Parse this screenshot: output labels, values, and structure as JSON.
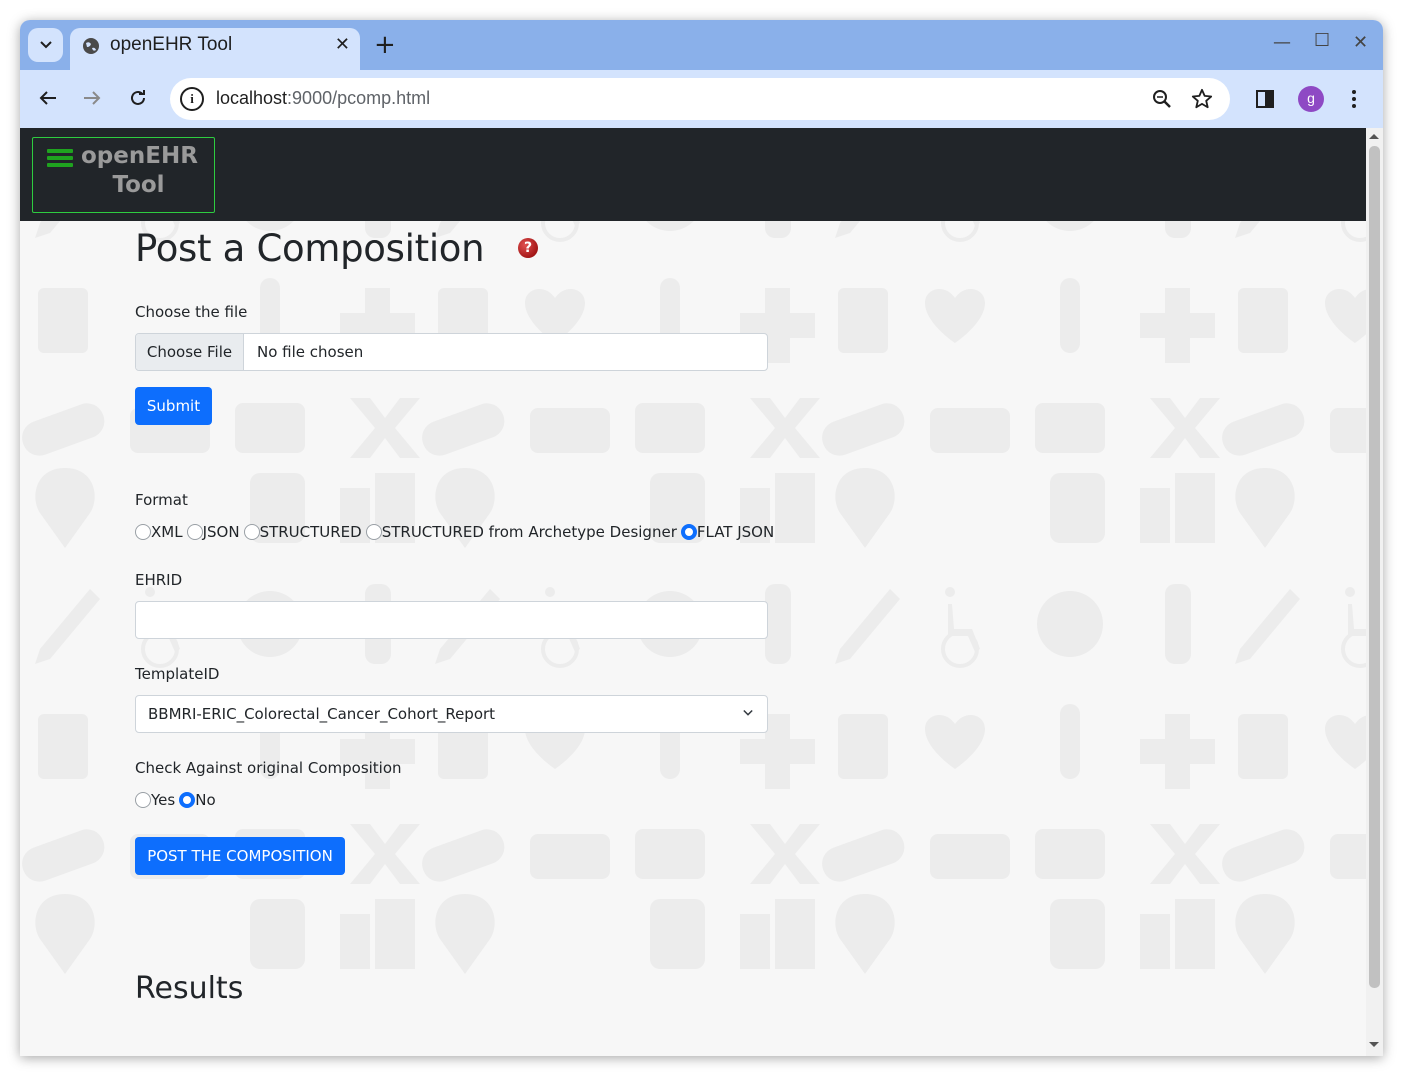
{
  "browser": {
    "tab_title": "openEHR Tool",
    "url_host": "localhost",
    "url_path": ":9000/pcomp.html",
    "profile_initial": "g"
  },
  "navbar": {
    "brand_line1": "openEHR",
    "brand_line2": "Tool"
  },
  "page": {
    "title": "Post a Composition",
    "help_icon": "?",
    "file_label": "Choose the file",
    "file_button": "Choose File",
    "file_status": "No file chosen",
    "submit_label": "Submit",
    "format_label": "Format",
    "format_options": [
      "XML",
      "JSON",
      "STRUCTURED",
      "STRUCTURED from Archetype Designer",
      "FLAT JSON"
    ],
    "format_selected": "FLAT JSON",
    "ehrid_label": "EHRID",
    "ehrid_value": "",
    "template_label": "TemplateID",
    "template_value": "BBMRI-ERIC_Colorectal_Cancer_Cohort_Report",
    "check_label": "Check Against original Composition",
    "check_options": [
      "Yes",
      "No"
    ],
    "check_selected": "No",
    "post_button": "POST THE COMPOSITION",
    "results_heading": "Results"
  },
  "colors": {
    "primary": "#0d6efd",
    "navbar": "#212529",
    "brand_border": "#2ecc40"
  }
}
